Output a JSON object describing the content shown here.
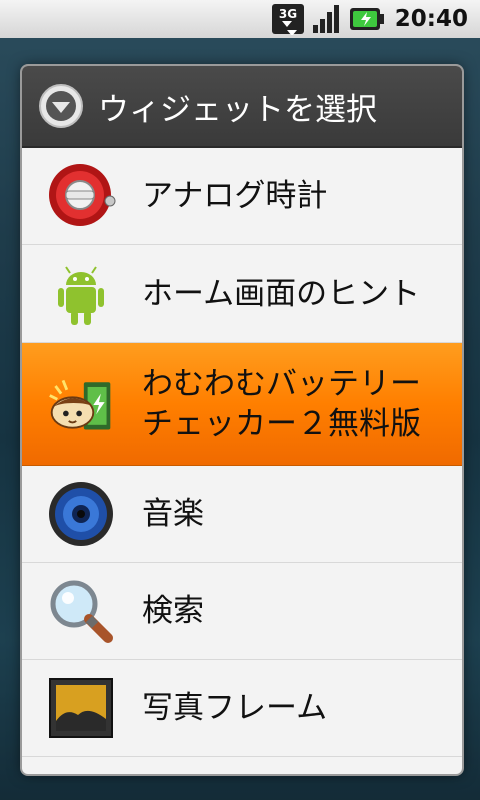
{
  "status_bar": {
    "network": "3G",
    "time": "20:40"
  },
  "dialog": {
    "title": "ウィジェットを選択",
    "items": [
      {
        "label": "アナログ時計",
        "icon": "analog-clock-icon"
      },
      {
        "label": "ホーム画面のヒント",
        "icon": "android-robot-icon"
      },
      {
        "label": "わむわむバッテリーチェッカー２無料版",
        "icon": "battery-checker-app-icon",
        "selected": true
      },
      {
        "label": "音楽",
        "icon": "music-speaker-icon"
      },
      {
        "label": "検索",
        "icon": "magnifier-icon"
      },
      {
        "label": "写真フレーム",
        "icon": "photo-frame-icon"
      }
    ]
  },
  "colors": {
    "selection": "#ff8a00",
    "title_bar": "#3f3f3f",
    "dialog_bg": "#f3f3f3"
  }
}
